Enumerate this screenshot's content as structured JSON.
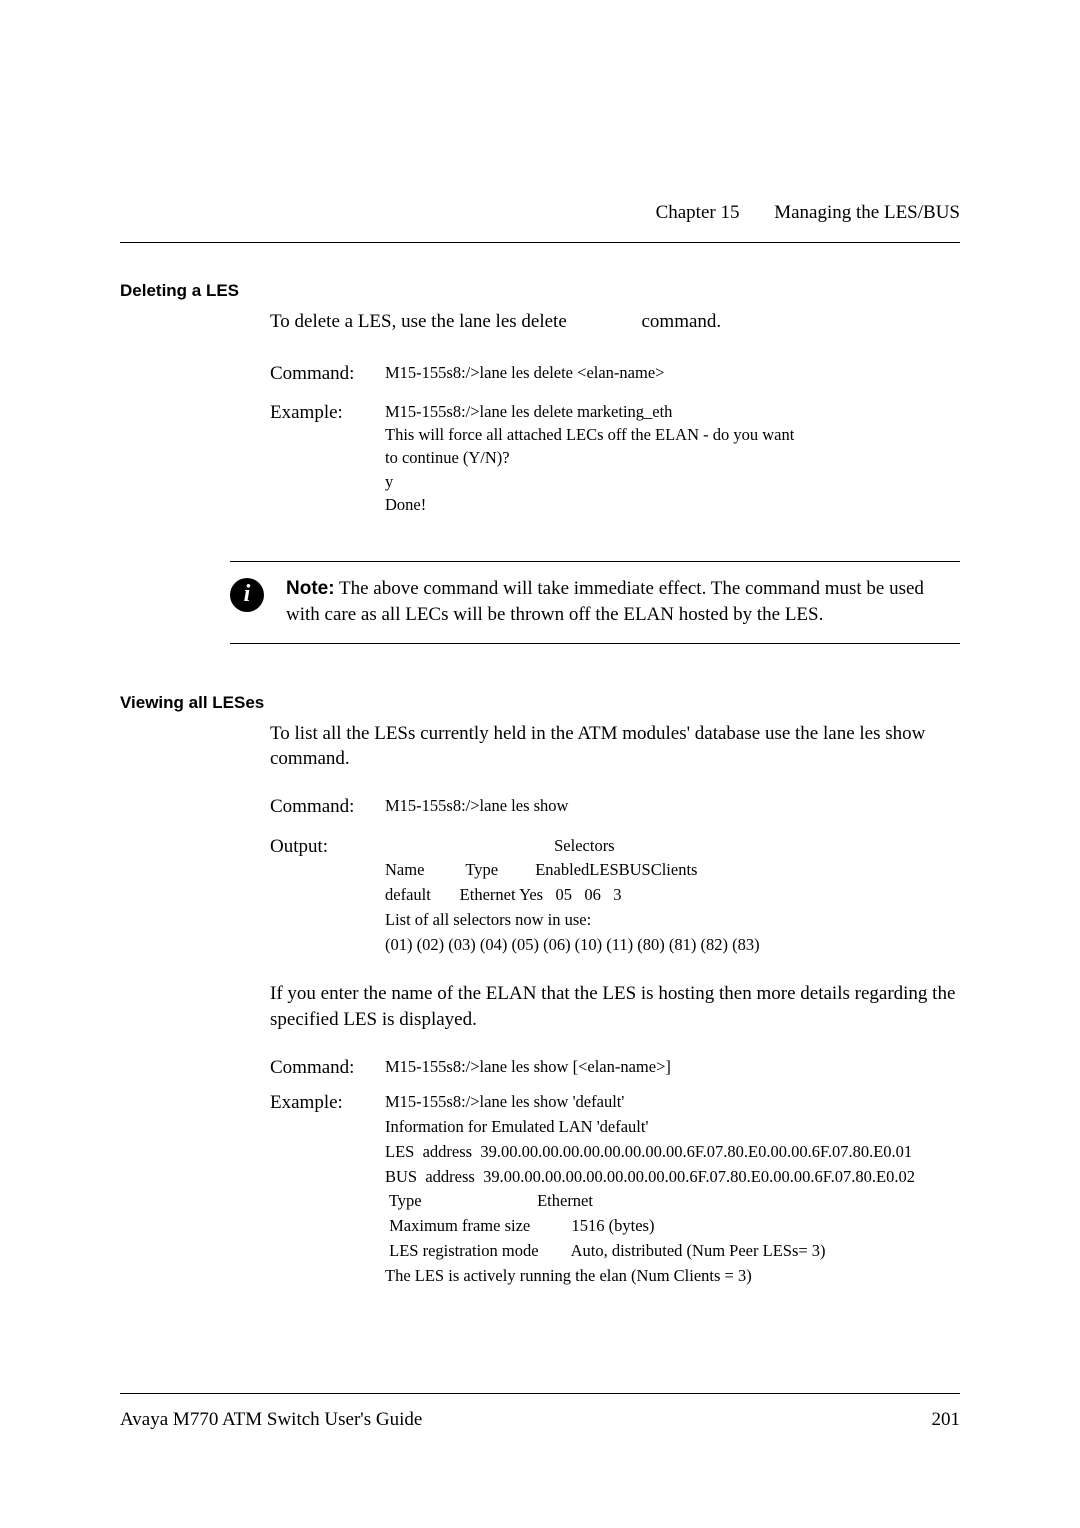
{
  "header": {
    "chapter": "Chapter 15",
    "title": "Managing the LES/BUS"
  },
  "sec1": {
    "heading": "Deleting a LES",
    "intro_pre": "To delete a LES, use the ",
    "intro_cmd": "lane les delete",
    "intro_post": " command.",
    "cmd_label": "Command:",
    "cmd_text": "M15-155s8:/>lane les delete <elan-name>",
    "ex_label": "Example:",
    "ex_l1": "M15-155s8:/>lane les delete marketing_eth",
    "ex_l2": "This will force all attached LECs off the ELAN - do you want",
    "ex_l3": "to continue (Y/N)?",
    "ex_l4": "y",
    "ex_l5": "Done!"
  },
  "note": {
    "label": "Note:",
    "text": " The above command will take immediate effect. The command must be used with care as all LECs will be thrown off the ELAN hosted by the LES."
  },
  "sec2": {
    "heading": "Viewing all LESes",
    "intro_pre": "To list all the LESs currently held in the ATM modules' database use the ",
    "intro_cmd": "lane les show",
    "intro_post": " command.",
    "cmd_label": "Command:",
    "cmd_text": "M15-155s8:/>lane les show",
    "out_label": "Output:",
    "out_l1": "                                         Selectors",
    "out_l2": "Name          Type         EnabledLESBUSClients",
    "out_l3": "default       Ethernet Yes   05   06   3",
    "out_l4": "",
    "out_l5": "List of all selectors now in use:",
    "out_l6": "(01) (02) (03) (04) (05) (06) (10) (11) (80) (81) (82) (83)",
    "para2": "If you enter the name of the ELAN that the LES is hosting then more details regarding the specified LES is displayed.",
    "cmd2_label": "Command:",
    "cmd2_text": "M15-155s8:/>lane les show [<elan-name>]",
    "ex2_label": "Example:",
    "ex2_l1": "M15-155s8:/>lane les show 'default'",
    "ex2_l2": "Information for Emulated LAN 'default'",
    "ex2_l3": "LES  address  39.00.00.00.00.00.00.00.00.00.6F.07.80.E0.00.00.6F.07.80.E0.01",
    "ex2_l4": "BUS  address  39.00.00.00.00.00.00.00.00.00.6F.07.80.E0.00.00.6F.07.80.E0.02",
    "ex2_l5": " Type                            Ethernet",
    "ex2_l6": " Maximum frame size          1516 (bytes)",
    "ex2_l7": " LES registration mode        Auto, distributed (Num Peer LESs= 3)",
    "ex2_l8": "The LES is actively running the elan (Num Clients = 3)"
  },
  "footer": {
    "left": "Avaya M770 ATM Switch User's Guide",
    "right": "201"
  }
}
